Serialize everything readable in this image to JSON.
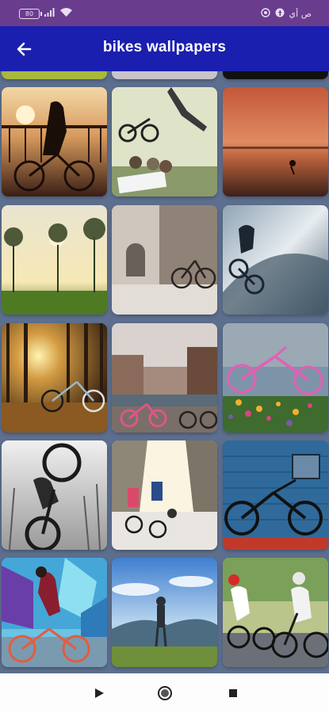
{
  "status_bar": {
    "battery": "80",
    "network_icons": [
      "signal-icon",
      "wifi-icon"
    ],
    "carrier_text": "ص أي",
    "app_icons": [
      "whatsapp-icon",
      "facebook-icon"
    ]
  },
  "app_bar": {
    "title": "bikes wallpapers",
    "back_icon": "arrow-left-icon",
    "background": "#1b1faf"
  },
  "colors": {
    "status_bar": "#6a3c8e",
    "app_bar": "#1b1faf",
    "grid_background": "#5d6f8f",
    "nav_bar": "#fdfdfd"
  },
  "wallpapers": [
    {
      "name": "sunset-cyclist-railing"
    },
    {
      "name": "bmx-jump-slide-box"
    },
    {
      "name": "red-sky-beach-cyclist"
    },
    {
      "name": "trees-silhouette-sunrise"
    },
    {
      "name": "bike-old-town-street"
    },
    {
      "name": "bmx-stormy-sky"
    },
    {
      "name": "autumn-forest-bike"
    },
    {
      "name": "pink-bike-canal"
    },
    {
      "name": "pink-bike-flowers"
    },
    {
      "name": "mountain-bike-jump-bw"
    },
    {
      "name": "city-street-cyclists"
    },
    {
      "name": "black-bike-blue-wall"
    },
    {
      "name": "graffiti-wall-cyclist"
    },
    {
      "name": "mountain-view-cyclist"
    },
    {
      "name": "road-cyclists-race"
    }
  ],
  "nav_bar": {
    "icons": [
      "back-triangle-icon",
      "home-circle-icon",
      "recents-square-icon"
    ]
  }
}
